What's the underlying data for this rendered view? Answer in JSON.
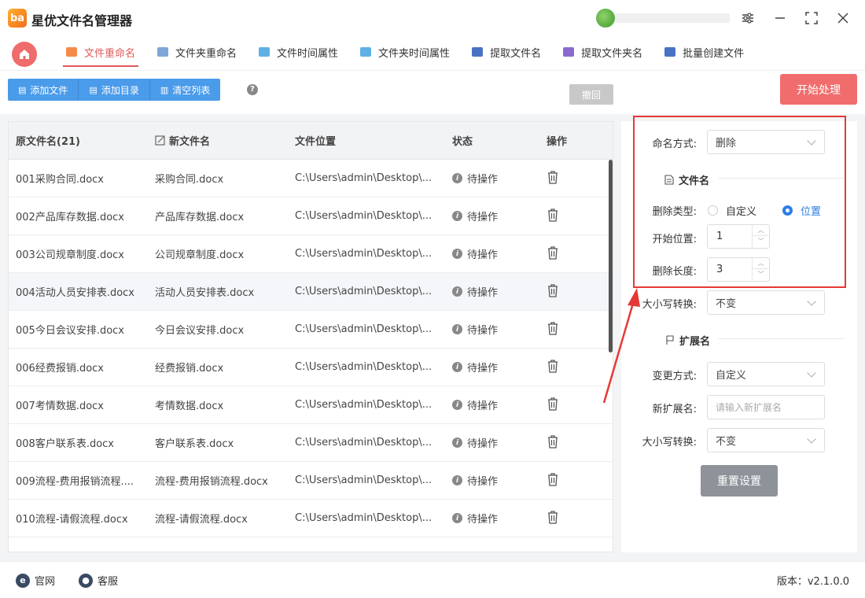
{
  "app": {
    "logo_text": "ba",
    "title": "星优文件名管理器"
  },
  "tabs": [
    {
      "label": "文件重命名",
      "color": "#f58a4a",
      "active": true
    },
    {
      "label": "文件夹重命名",
      "color": "#7fa6d8"
    },
    {
      "label": "文件时间属性",
      "color": "#5eb0e5"
    },
    {
      "label": "文件夹时间属性",
      "color": "#5eb0e5"
    },
    {
      "label": "提取文件名",
      "color": "#4a72c4"
    },
    {
      "label": "提取文件夹名",
      "color": "#8a6ad0"
    },
    {
      "label": "批量创建文件",
      "color": "#4a72c4"
    }
  ],
  "toolbar": {
    "add_file": "添加文件",
    "add_dir": "添加目录",
    "clear_list": "清空列表",
    "help": "?",
    "undo": "撤回",
    "start": "开始处理"
  },
  "table": {
    "headers": [
      "原文件名(21)",
      "新文件名",
      "文件位置",
      "状态",
      "操作"
    ],
    "rows": [
      {
        "orig": "001采购合同.docx",
        "new": "采购合同.docx",
        "loc": "C:\\Users\\admin\\Desktop\\...",
        "status": "待操作"
      },
      {
        "orig": "002产品库存数据.docx",
        "new": "产品库存数据.docx",
        "loc": "C:\\Users\\admin\\Desktop\\...",
        "status": "待操作"
      },
      {
        "orig": "003公司规章制度.docx",
        "new": "公司规章制度.docx",
        "loc": "C:\\Users\\admin\\Desktop\\...",
        "status": "待操作"
      },
      {
        "orig": "004活动人员安排表.docx",
        "new": "活动人员安排表.docx",
        "loc": "C:\\Users\\admin\\Desktop\\...",
        "status": "待操作"
      },
      {
        "orig": "005今日会议安排.docx",
        "new": "今日会议安排.docx",
        "loc": "C:\\Users\\admin\\Desktop\\...",
        "status": "待操作"
      },
      {
        "orig": "006经费报销.docx",
        "new": "经费报销.docx",
        "loc": "C:\\Users\\admin\\Desktop\\...",
        "status": "待操作"
      },
      {
        "orig": "007考情数据.docx",
        "new": "考情数据.docx",
        "loc": "C:\\Users\\admin\\Desktop\\...",
        "status": "待操作"
      },
      {
        "orig": "008客户联系表.docx",
        "new": "客户联系表.docx",
        "loc": "C:\\Users\\admin\\Desktop\\...",
        "status": "待操作"
      },
      {
        "orig": "009流程-费用报销流程....",
        "new": "流程-费用报销流程.docx",
        "loc": "C:\\Users\\admin\\Desktop\\...",
        "status": "待操作"
      },
      {
        "orig": "010流程-请假流程.docx",
        "new": "流程-请假流程.docx",
        "loc": "C:\\Users\\admin\\Desktop\\...",
        "status": "待操作"
      }
    ]
  },
  "panel": {
    "naming_label": "命名方式:",
    "naming_value": "删除",
    "filename_section": "文件名",
    "delete_type_label": "删除类型:",
    "delete_type_custom": "自定义",
    "delete_type_position": "位置",
    "start_pos_label": "开始位置:",
    "start_pos_value": "1",
    "delete_len_label": "删除长度:",
    "delete_len_value": "3",
    "case_label": "大小写转换:",
    "case_value": "不变",
    "ext_section": "扩展名",
    "change_mode_label": "变更方式:",
    "change_mode_value": "自定义",
    "new_ext_label": "新扩展名:",
    "new_ext_placeholder": "请输入新扩展名",
    "ext_case_label": "大小写转换:",
    "ext_case_value": "不变",
    "reset": "重置设置"
  },
  "footer": {
    "website": "官网",
    "support": "客服",
    "version": "版本：v2.1.0.0"
  },
  "colors": {
    "accent": "#e05a5a",
    "primary": "#4a9bea",
    "highlight_box": "#e53935"
  }
}
